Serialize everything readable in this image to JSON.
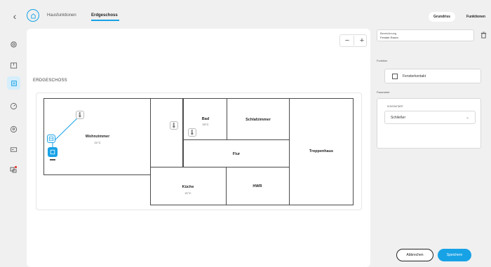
{
  "header": {
    "back_icon": "chevron-left-icon",
    "home_icon": "home-icon",
    "tabs": [
      "Hausfunktionen",
      "Erdgeschoss"
    ],
    "active_tab": "Erdgeschoss"
  },
  "view_toggle": {
    "options": [
      "Grundriss",
      "Funktionen"
    ],
    "selected": "Grundriss"
  },
  "sidebar": {
    "items": [
      {
        "icon": "settings-icon"
      },
      {
        "icon": "floorplan-icon"
      },
      {
        "icon": "list-icon",
        "active": true
      },
      {
        "icon": "gauge-icon"
      },
      {
        "icon": "location-icon"
      },
      {
        "icon": "screen-icon"
      },
      {
        "icon": "network-alert-icon"
      }
    ]
  },
  "canvas": {
    "floor_title": "ERDGESCHOSS",
    "zoom_out": "−",
    "zoom_in": "+",
    "rooms": [
      {
        "name": "Wohnzimmer",
        "temp": "21°C"
      },
      {
        "name": "Bad",
        "temp": "20°C"
      },
      {
        "name": "Schlafzimmer",
        "temp": ""
      },
      {
        "name": "Flur",
        "temp": ""
      },
      {
        "name": "Küche",
        "temp": "21°C"
      },
      {
        "name": "HWR",
        "temp": ""
      },
      {
        "name": "Treppenhaus",
        "temp": ""
      }
    ]
  },
  "panel": {
    "name_label": "Bezeichnung",
    "name_value": "Fenster Essen",
    "function_label": "Funktion",
    "function_value": "Fensterkontakt",
    "params_label": "Parameter",
    "contact_type_label": "KONTAKTART",
    "contact_type_value": "Schließer"
  },
  "actions": {
    "cancel": "Abbrechen",
    "save": "Speichern"
  },
  "colors": {
    "accent": "#17a2e6",
    "background": "#f0f0f0",
    "wall": "#4a4a4a"
  }
}
